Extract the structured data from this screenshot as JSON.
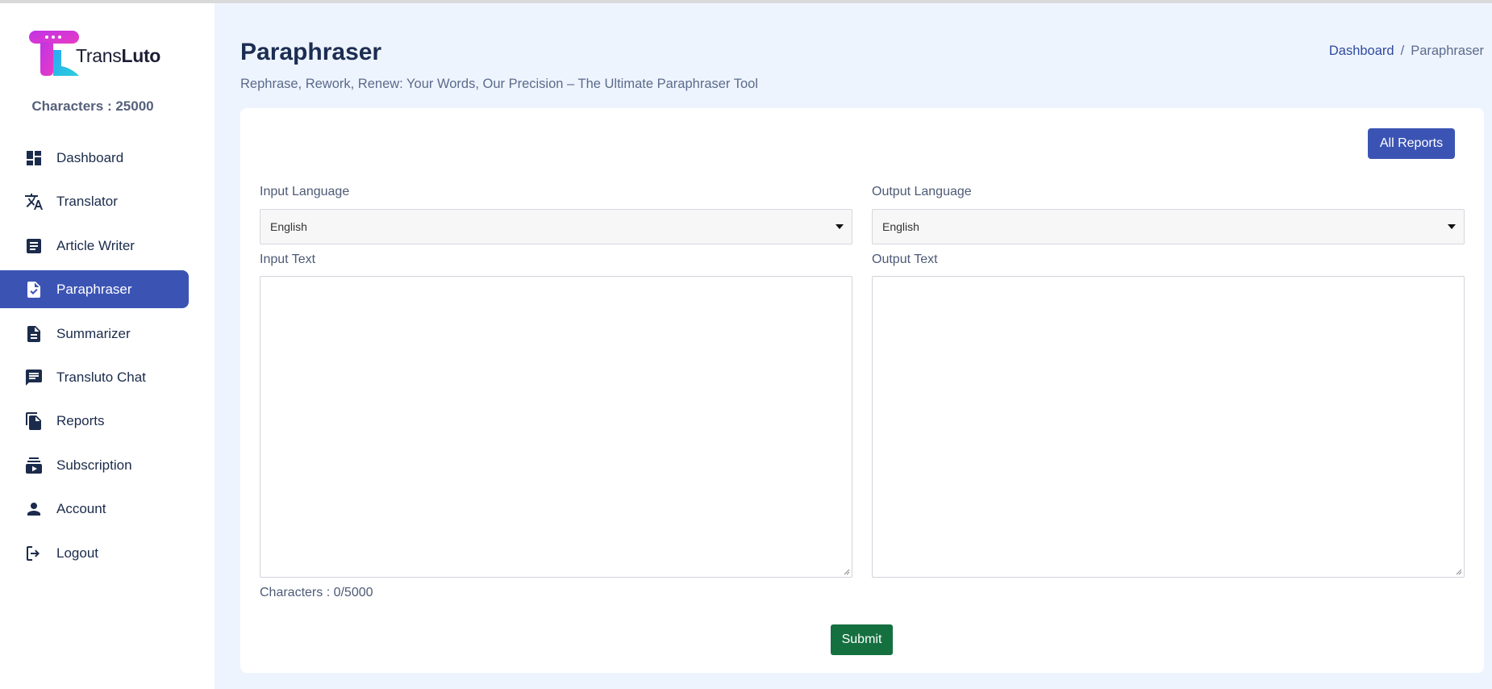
{
  "brand": {
    "name_light": "Trans",
    "name_bold": "Luto"
  },
  "sidebar": {
    "characters": "Characters : 25000",
    "items": [
      {
        "label": "Dashboard",
        "icon": "dashboard-icon"
      },
      {
        "label": "Translator",
        "icon": "translate-icon"
      },
      {
        "label": "Article Writer",
        "icon": "article-icon"
      },
      {
        "label": "Paraphraser",
        "icon": "file-check-icon",
        "active": true
      },
      {
        "label": "Summarizer",
        "icon": "document-icon"
      },
      {
        "label": "Transluto Chat",
        "icon": "chat-icon"
      },
      {
        "label": "Reports",
        "icon": "reports-icon"
      },
      {
        "label": "Subscription",
        "icon": "subscription-icon"
      },
      {
        "label": "Account",
        "icon": "person-icon"
      },
      {
        "label": "Logout",
        "icon": "logout-icon"
      }
    ]
  },
  "header": {
    "title": "Paraphraser",
    "subtitle": "Rephrase, Rework, Renew: Your Words, Our Precision – The Ultimate Paraphraser Tool",
    "breadcrumb": {
      "home": "Dashboard",
      "separator": "/",
      "current": "Paraphraser"
    }
  },
  "card": {
    "all_reports": "All Reports",
    "input_language_label": "Input Language",
    "input_language_value": "English",
    "output_language_label": "Output Language",
    "output_language_value": "English",
    "input_text_label": "Input Text",
    "output_text_label": "Output Text",
    "character_counter": "Characters : 0/5000",
    "submit": "Submit"
  },
  "colors": {
    "accent": "#3b54b4",
    "submit": "#157040",
    "page_bg": "#eef4fd"
  }
}
